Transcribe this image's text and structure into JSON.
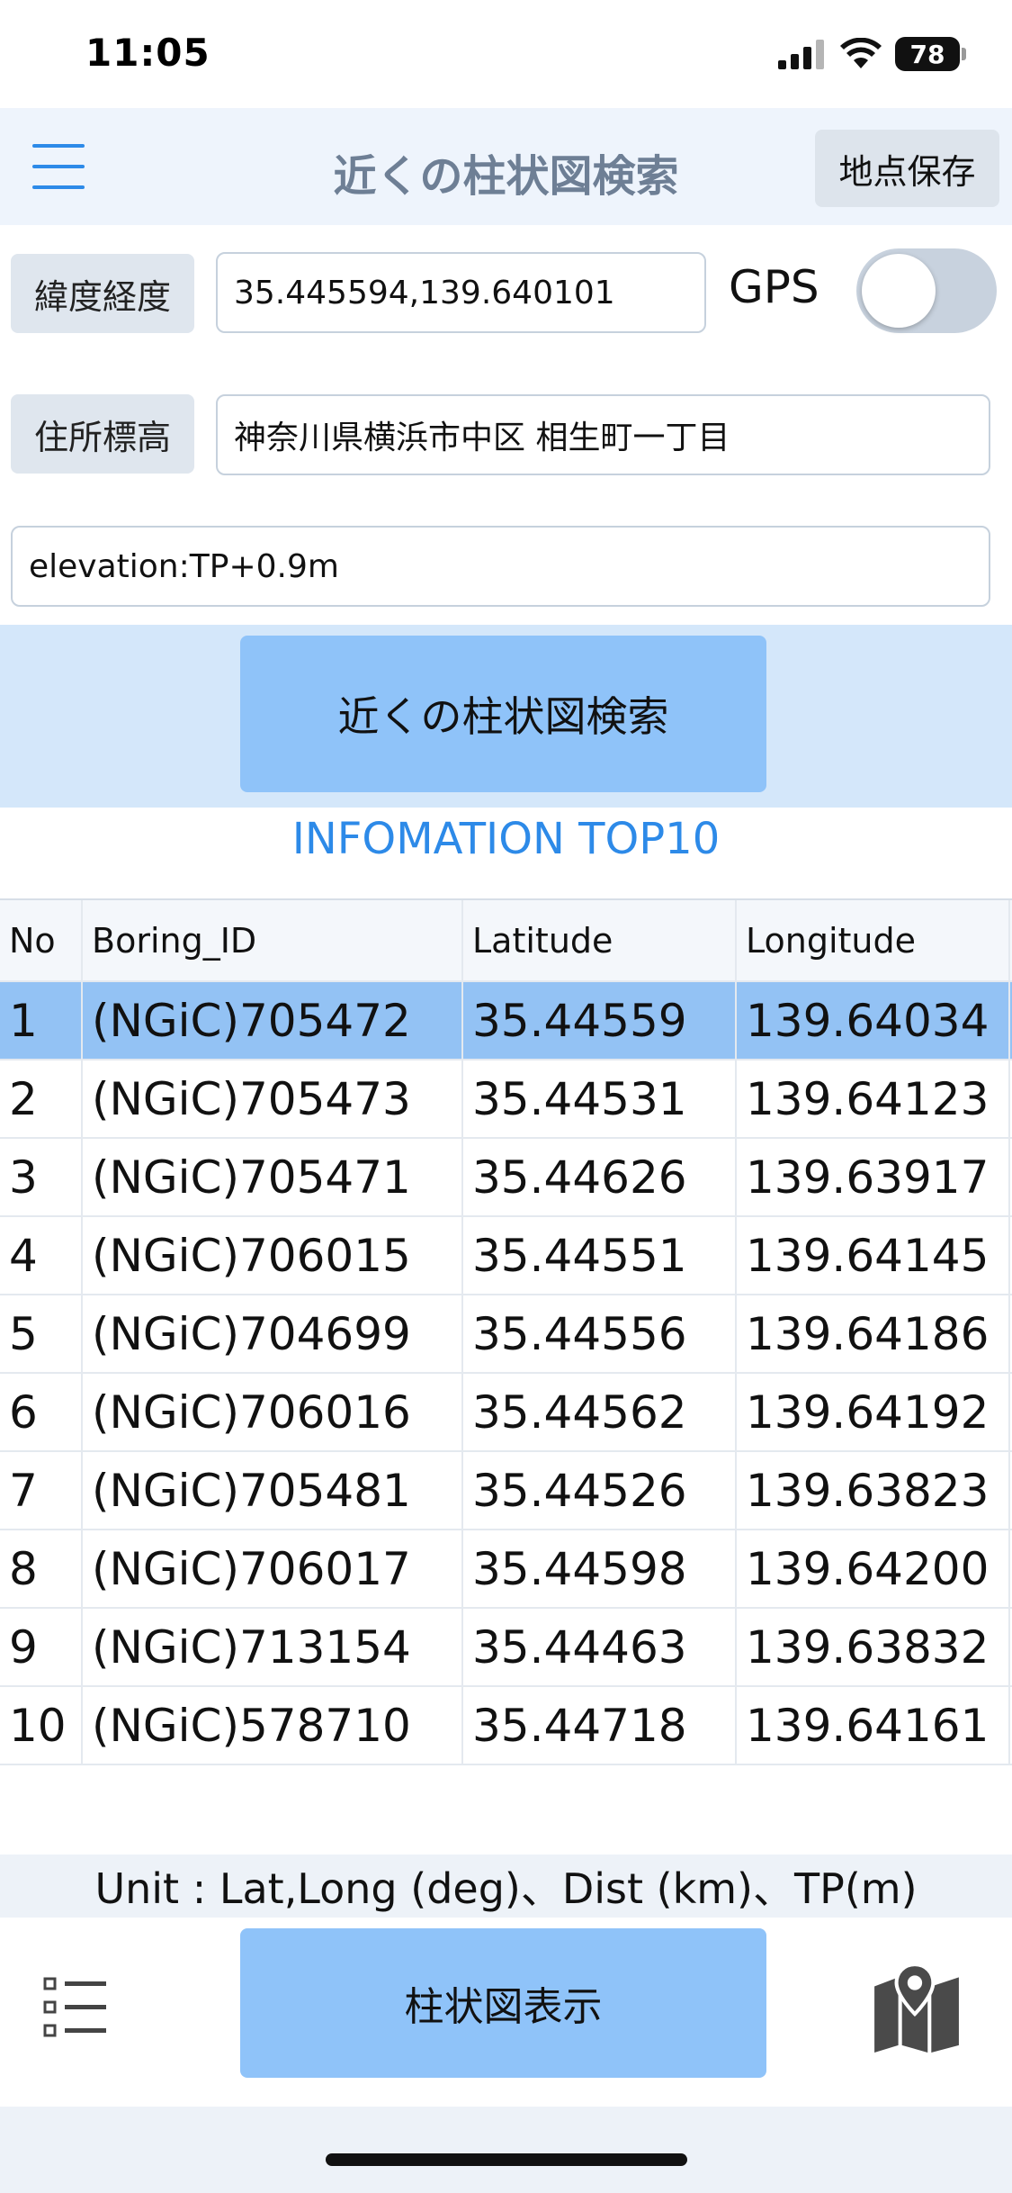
{
  "status_bar": {
    "time": "11:05",
    "battery": "78"
  },
  "header": {
    "title": "近くの柱状図検索",
    "save_label": "地点保存"
  },
  "form": {
    "latlng_label": "緯度経度",
    "latlng_value": "35.445594,139.640101",
    "gps_label": "GPS",
    "address_label": "住所標高",
    "address_value": "神奈川県横浜市中区 相生町一丁目",
    "elevation_value": "elevation:TP+0.9m"
  },
  "search_button_label": "近くの柱状図検索",
  "info_title": "INFOMATION TOP10",
  "table": {
    "headers": [
      "No",
      "Boring_ID",
      "Latitude",
      "Longitude"
    ],
    "rows": [
      [
        "1",
        "(NGiC)705472",
        "35.44559",
        "139.64034"
      ],
      [
        "2",
        "(NGiC)705473",
        "35.44531",
        "139.64123"
      ],
      [
        "3",
        "(NGiC)705471",
        "35.44626",
        "139.63917"
      ],
      [
        "4",
        "(NGiC)706015",
        "35.44551",
        "139.64145"
      ],
      [
        "5",
        "(NGiC)704699",
        "35.44556",
        "139.64186"
      ],
      [
        "6",
        "(NGiC)706016",
        "35.44562",
        "139.64192"
      ],
      [
        "7",
        "(NGiC)705481",
        "35.44526",
        "139.63823"
      ],
      [
        "8",
        "(NGiC)706017",
        "35.44598",
        "139.64200"
      ],
      [
        "9",
        "(NGiC)713154",
        "35.44463",
        "139.63832"
      ],
      [
        "10",
        "(NGiC)578710",
        "35.44718",
        "139.64161"
      ]
    ]
  },
  "unit_text": "Unit : Lat,Long (deg)、Dist (km)、TP(m)",
  "show_button_label": "柱状図表示",
  "icons": {
    "menu": "hamburger-menu-icon",
    "list": "list-icon",
    "map": "map-pin-icon",
    "signal": "cellular-signal-icon",
    "wifi": "wifi-icon",
    "battery": "battery-icon"
  },
  "colors": {
    "accent": "#2d8ae8",
    "button_blue": "#8fc3f9",
    "selected_row": "#93c2f4",
    "header_bg": "#eef4fc"
  }
}
